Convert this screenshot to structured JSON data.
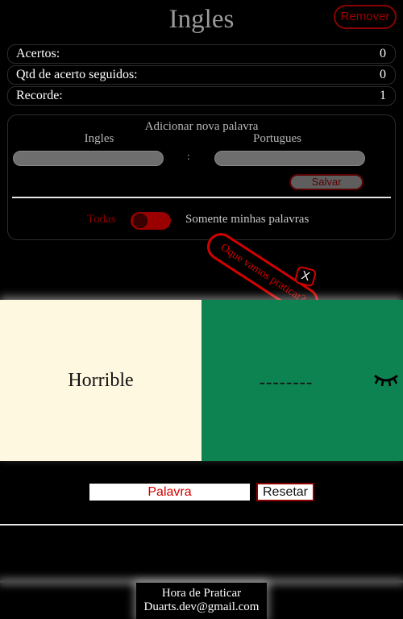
{
  "header": {
    "title": "Ingles",
    "remove_label": "Remover"
  },
  "stats": [
    {
      "label": "Acertos:",
      "value": "0"
    },
    {
      "label": "Qtd de acerto seguidos:",
      "value": "0"
    },
    {
      "label": "Recorde:",
      "value": "1"
    }
  ],
  "add_word": {
    "title": "Adicionar nova palavra",
    "english_label": "Ingles",
    "portuguese_label": "Portugues",
    "separator": ":",
    "save_label": "Salvar"
  },
  "filter": {
    "left_label": "Todas",
    "right_label": "Somente minhas palavras"
  },
  "prompt_tag": {
    "text": "Oque vamos praticar?",
    "close": "X"
  },
  "card": {
    "word": "Horrible",
    "hidden": "--------",
    "icon": "eye-closed-icon"
  },
  "answer": {
    "placeholder": "Palavra",
    "reset_label": "Resetar"
  },
  "footer": {
    "line1": "Hora de Praticar",
    "line2": "Duarts.dev@gmail.com"
  },
  "colors": {
    "accent": "#8b0000",
    "card_left": "#fff8e0",
    "card_right": "#0e8352"
  }
}
